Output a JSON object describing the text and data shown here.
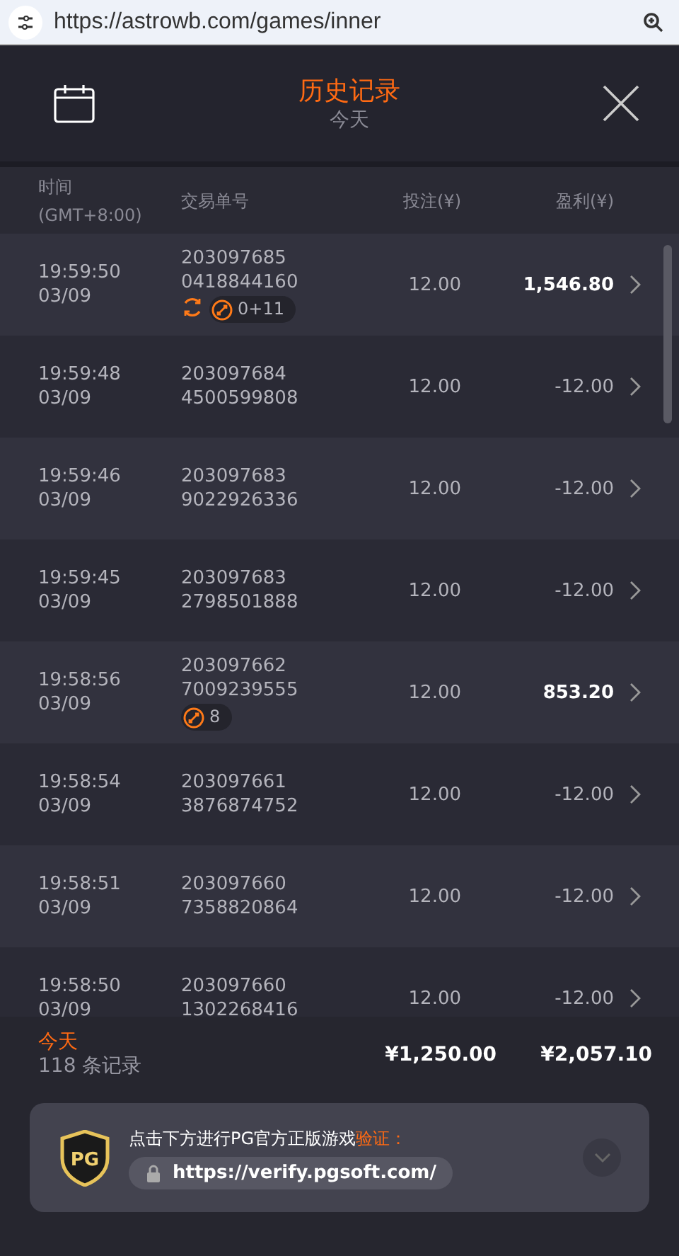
{
  "browser": {
    "url": "https://astrowb.com/games/inner"
  },
  "header": {
    "title": "历史记录",
    "subtitle": "今天"
  },
  "table": {
    "columns": [
      {
        "lines": [
          "时间",
          "(GMT+8:00)"
        ]
      },
      {
        "lines": [
          "交易单号"
        ]
      },
      {
        "lines": [
          "投注(¥)"
        ]
      },
      {
        "lines": [
          "盈利(¥)"
        ]
      }
    ],
    "rows": [
      {
        "time": "19:59:50",
        "date": "03/09",
        "id": [
          "203097685",
          "0418844160"
        ],
        "bet": "12.00",
        "profit": "1,546.80",
        "positive": true,
        "badges": [
          {
            "kind": "cycle"
          },
          {
            "kind": "free",
            "text": "0+11"
          }
        ]
      },
      {
        "time": "19:59:48",
        "date": "03/09",
        "id": [
          "203097684",
          "4500599808"
        ],
        "bet": "12.00",
        "profit": "-12.00",
        "positive": false,
        "badges": []
      },
      {
        "time": "19:59:46",
        "date": "03/09",
        "id": [
          "203097683",
          "9022926336"
        ],
        "bet": "12.00",
        "profit": "-12.00",
        "positive": false,
        "badges": []
      },
      {
        "time": "19:59:45",
        "date": "03/09",
        "id": [
          "203097683",
          "2798501888"
        ],
        "bet": "12.00",
        "profit": "-12.00",
        "positive": false,
        "badges": []
      },
      {
        "time": "19:58:56",
        "date": "03/09",
        "id": [
          "203097662",
          "7009239555"
        ],
        "bet": "12.00",
        "profit": "853.20",
        "positive": true,
        "badges": [
          {
            "kind": "free",
            "text": "8"
          }
        ]
      },
      {
        "time": "19:58:54",
        "date": "03/09",
        "id": [
          "203097661",
          "3876874752"
        ],
        "bet": "12.00",
        "profit": "-12.00",
        "positive": false,
        "badges": []
      },
      {
        "time": "19:58:51",
        "date": "03/09",
        "id": [
          "203097660",
          "7358820864"
        ],
        "bet": "12.00",
        "profit": "-12.00",
        "positive": false,
        "badges": []
      },
      {
        "time": "19:58:50",
        "date": "03/09",
        "id": [
          "203097660",
          "1302268416"
        ],
        "bet": "12.00",
        "profit": "-12.00",
        "positive": false,
        "badges": []
      }
    ]
  },
  "summary": {
    "period": "今天",
    "count": "118 条记录",
    "bet_total": "¥1,250.00",
    "profit_total": "¥2,057.10"
  },
  "verify": {
    "logo": "PG",
    "message": "点击下方进行PG官方正版游戏**验证：**",
    "url": "https://verify.pgsoft.com/"
  }
}
